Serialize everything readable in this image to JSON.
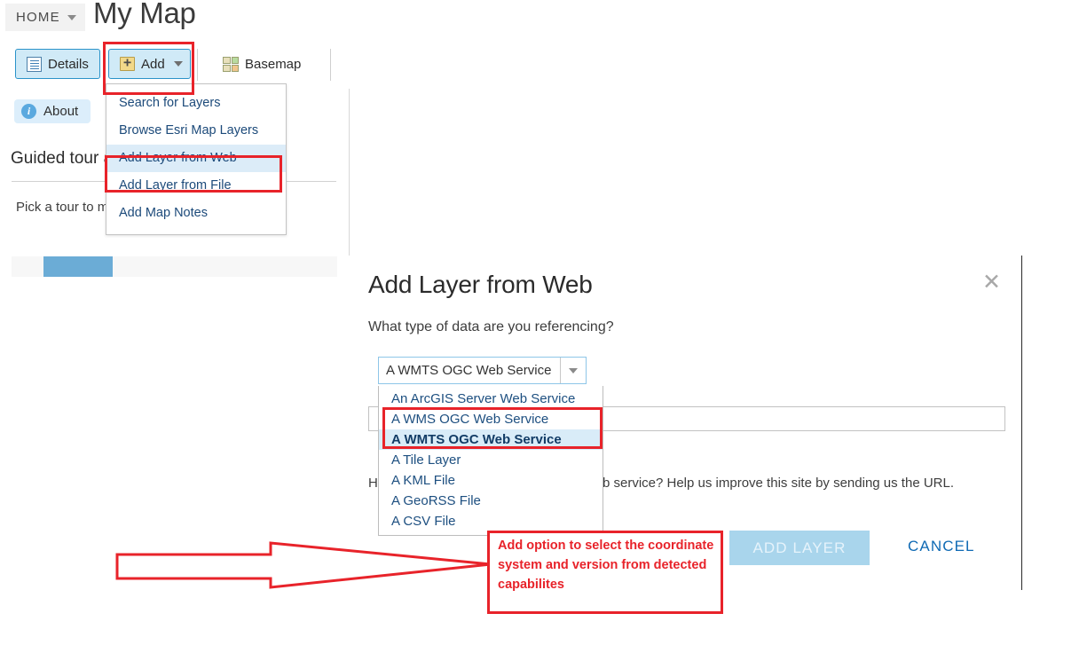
{
  "header": {
    "home_label": "HOME",
    "home_caret_icon": "chevron-down-icon",
    "map_title": "My Map"
  },
  "toolbar": {
    "details_label": "Details",
    "details_icon": "details-list-icon",
    "add_label": "Add",
    "add_icon": "add-plus-icon",
    "add_caret_icon": "chevron-down-icon",
    "basemap_label": "Basemap",
    "basemap_icon": "basemap-grid-icon"
  },
  "add_menu": {
    "items": [
      {
        "label": "Search for Layers",
        "selected": false
      },
      {
        "label": "Browse Esri Map Layers",
        "selected": false
      },
      {
        "label": "Add Layer from Web",
        "selected": true
      },
      {
        "label": "Add Layer from File",
        "selected": false
      },
      {
        "label": "Add Map Notes",
        "selected": false
      }
    ]
  },
  "left_panel": {
    "about_label": "About",
    "about_icon": "info-icon",
    "heading": "Guided tour                              arted",
    "body": "Pick a tour to                              map viewer."
  },
  "dialog": {
    "title": "Add Layer from Web",
    "close_icon": "close-icon",
    "question": "What type of data are you referencing?",
    "select": {
      "value": "A WMTS OGC Web Service",
      "caret_icon": "chevron-down-icon",
      "options": [
        {
          "label": "An ArcGIS Server Web Service",
          "active": false
        },
        {
          "label": "A WMS OGC Web Service",
          "active": false
        },
        {
          "label": "A WMTS OGC Web Service",
          "active": true
        },
        {
          "label": "A Tile Layer",
          "active": false
        },
        {
          "label": "A KML File",
          "active": false
        },
        {
          "label": "A GeoRSS File",
          "active": false
        },
        {
          "label": "A CSV File",
          "active": false
        }
      ]
    },
    "url_input_value": "",
    "url_input_placeholder": "",
    "help_text": "Having trouble using a WMTS OGC Web service? Help us improve this site by sending us the URL.",
    "add_layer_label": "ADD LAYER",
    "cancel_label": "CANCEL"
  },
  "annotations": {
    "note": "Add option to select the coordinate system and version from detected capabilites",
    "arrow_icon": "right-arrow-annotation",
    "highlight_color": "#e8232a"
  }
}
